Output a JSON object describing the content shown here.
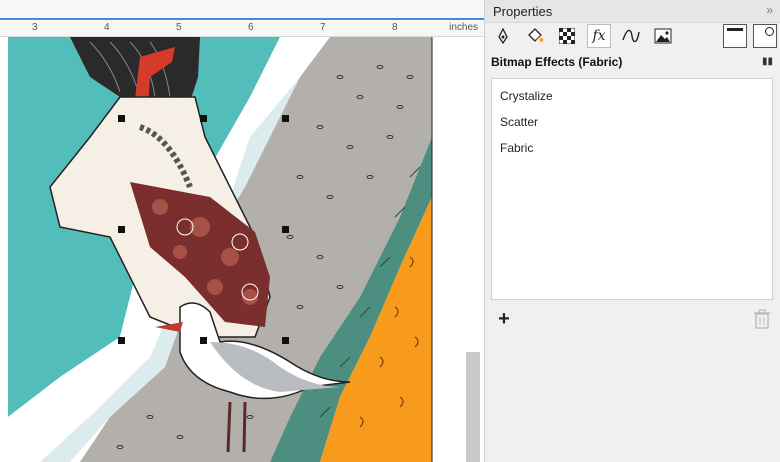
{
  "ruler": {
    "numbers": [
      "3",
      "4",
      "5",
      "6",
      "7",
      "8"
    ],
    "unit": "inches"
  },
  "panel": {
    "title": "Properties",
    "collapse_glyph": "»",
    "tabs": [
      {
        "icon": "outline-pen-icon"
      },
      {
        "icon": "fill-bucket-icon"
      },
      {
        "icon": "transparency-icon"
      },
      {
        "icon": "fx-effects-icon",
        "label": "fx"
      },
      {
        "icon": "curve-icon"
      },
      {
        "icon": "bitmap-image-icon"
      }
    ],
    "right_tabs": [
      {
        "icon": "frame-icon"
      },
      {
        "icon": "frame-settings-icon"
      }
    ],
    "section_title": "Bitmap Effects (Fabric)",
    "effects": [
      "Crystalize",
      "Scatter",
      "Fabric"
    ],
    "add_glyph": "+"
  },
  "colors": {
    "ruler_line": "#3f8fd6",
    "teal": "#52bdb9",
    "sand": "#b3b0ac",
    "orange": "#f89a1c",
    "seaweed": "#4c8f81"
  }
}
